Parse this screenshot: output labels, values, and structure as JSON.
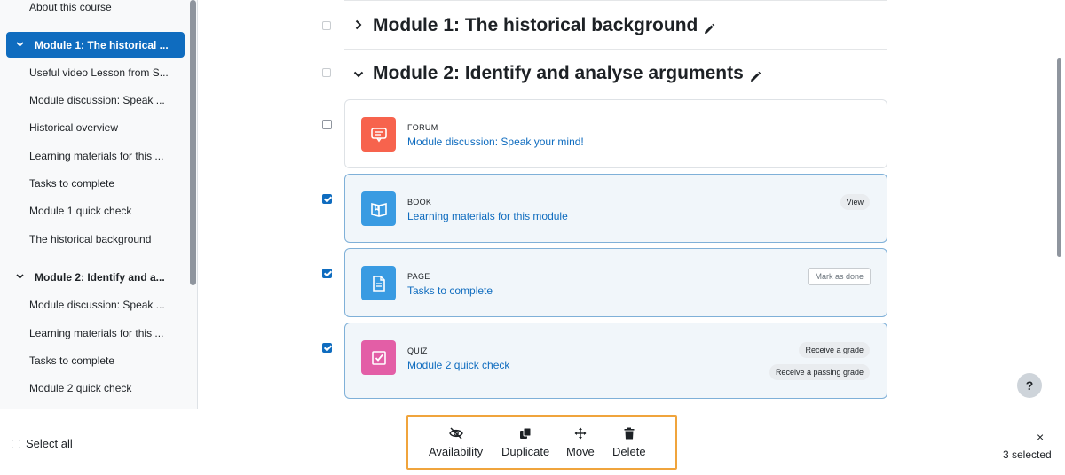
{
  "sidebar": {
    "items": [
      {
        "label": "About this course"
      },
      {
        "label": "Module 1: The historical ..."
      },
      {
        "label": "Useful video Lesson from S..."
      },
      {
        "label": "Module discussion: Speak ..."
      },
      {
        "label": "Historical overview"
      },
      {
        "label": "Learning materials for this ..."
      },
      {
        "label": "Tasks to complete"
      },
      {
        "label": "Module 1 quick check"
      },
      {
        "label": "The historical background"
      },
      {
        "label": "Module 2: Identify and a..."
      },
      {
        "label": "Module discussion: Speak ..."
      },
      {
        "label": "Learning materials for this ..."
      },
      {
        "label": "Tasks to complete"
      },
      {
        "label": "Module 2 quick check"
      }
    ]
  },
  "main": {
    "sections": [
      {
        "title": "Module 1: The historical background",
        "expanded": false
      },
      {
        "title": "Module 2: Identify and analyse arguments",
        "expanded": true
      }
    ],
    "activities": [
      {
        "type": "FORUM",
        "name": "Module discussion: Speak your mind!",
        "selected": false,
        "icon": "forum-icon",
        "color": "#f7634d"
      },
      {
        "type": "BOOK",
        "name": "Learning materials for this module",
        "selected": true,
        "icon": "book-icon",
        "color": "#399be2",
        "badge": "View"
      },
      {
        "type": "PAGE",
        "name": "Tasks to complete",
        "selected": true,
        "icon": "page-icon",
        "color": "#399be2",
        "button": "Mark as done"
      },
      {
        "type": "QUIZ",
        "name": "Module 2 quick check",
        "selected": true,
        "icon": "quiz-icon",
        "color": "#e35ea6",
        "badges": [
          "Receive a grade",
          "Receive a passing grade"
        ]
      }
    ],
    "help_label": "?"
  },
  "bulk_bar": {
    "select_all_label": "Select all",
    "actions": [
      {
        "label": "Availability",
        "icon": "eye-slash-icon"
      },
      {
        "label": "Duplicate",
        "icon": "copy-icon"
      },
      {
        "label": "Move",
        "icon": "move-arrows-icon"
      },
      {
        "label": "Delete",
        "icon": "trash-icon"
      }
    ],
    "close_label": "×",
    "selected_count": "3 selected",
    "highlight_color": "#f0a43c"
  }
}
